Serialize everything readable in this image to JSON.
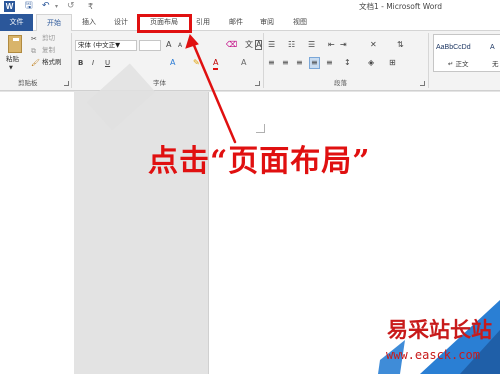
{
  "titlebar": {
    "title": "文档1 - Microsoft Word",
    "app_icon": "W",
    "qat": {
      "save_glyph": "🖫",
      "undo_glyph": "↶",
      "undo_arrow": "▾",
      "redo_glyph": "↺",
      "customize_glyph": "₹"
    }
  },
  "tabs": [
    {
      "label": "文件"
    },
    {
      "label": "开始"
    },
    {
      "label": "插入"
    },
    {
      "label": "设计"
    },
    {
      "label": "页面布局"
    },
    {
      "label": "引用"
    },
    {
      "label": "邮件"
    },
    {
      "label": "审阅"
    },
    {
      "label": "视图"
    }
  ],
  "ribbon": {
    "clipboard": {
      "paste_label": "粘贴",
      "cut_label": "剪切",
      "copy_label": "复制",
      "format_painter_label": "格式刷",
      "group_label": "剪贴板"
    },
    "font": {
      "font_name": "宋体 (中文正▼",
      "grow_font": "A",
      "shrink_font": "A",
      "bold": "B",
      "italic": "I",
      "underline": "U",
      "group_label": "字体"
    },
    "paragraph": {
      "group_label": "段落"
    },
    "styles": {
      "normal_sample": "AaBbCcDd",
      "normal_label": "↵ 正文",
      "next_sample": "A",
      "next_label": "无"
    }
  },
  "callout": {
    "text": "点击“页面布局”"
  },
  "watermark": {
    "name": "易采站长站",
    "url": "www.easck.com"
  },
  "colors": {
    "word_blue": "#2b579a",
    "highlight_red": "#e01010",
    "watermark_red": "#c81a1a",
    "watermark_blue": "#2a7fd4"
  }
}
